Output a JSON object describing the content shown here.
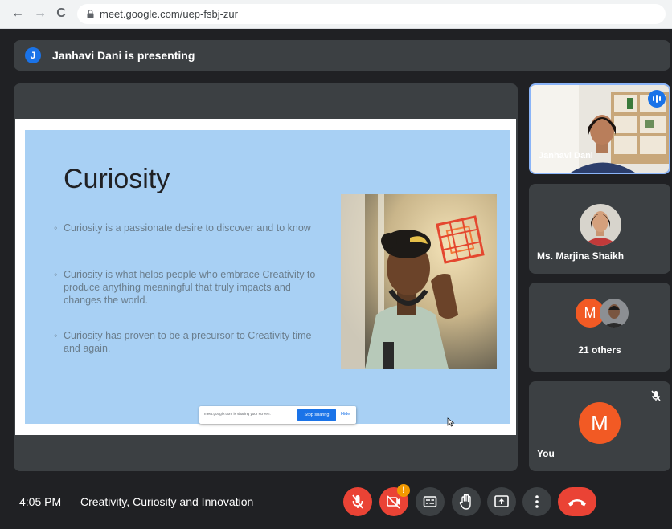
{
  "browser": {
    "url": "meet.google.com/uep-fsbj-zur"
  },
  "banner": {
    "avatar_letter": "J",
    "text": "Janhavi Dani is presenting"
  },
  "slide": {
    "title": "Curiosity",
    "bullets": [
      "Curiosity is a passionate desire to discover and to know",
      "Curiosity is what helps people who embrace Creativity to produce anything meaningful that truly impacts and changes the world.",
      "Curiosity has proven to be a precursor to Creativity time and again."
    ],
    "share_bar": {
      "message": "meet.google.com is sharing your screen.",
      "stop_label": "Stop sharing",
      "hide_label": "Hide"
    }
  },
  "participants": {
    "presenter": {
      "name": "Janhavi Dani"
    },
    "second": {
      "name": "Ms. Marjina Shaikh"
    },
    "others": {
      "avatar_letter": "M",
      "label": "21 others"
    },
    "self": {
      "avatar_letter": "M",
      "label": "You"
    }
  },
  "footer": {
    "time": "4:05 PM",
    "separator": "|",
    "meeting_title": "Creativity, Curiosity and Innovation",
    "camera_alert_badge": "!"
  },
  "colors": {
    "accent": "#1a73e8",
    "danger": "#ea4335",
    "avatar_orange": "#f25a24",
    "badge": "#f29900"
  }
}
